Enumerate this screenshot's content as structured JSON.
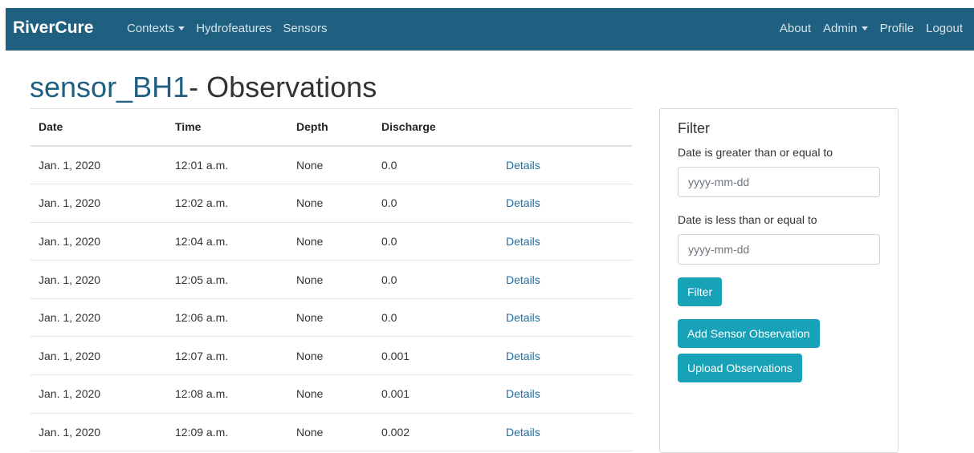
{
  "navbar": {
    "brand": "RiverCure",
    "left_links": [
      {
        "label": "Contexts",
        "dropdown": true
      },
      {
        "label": "Hydrofeatures",
        "dropdown": false
      },
      {
        "label": "Sensors",
        "dropdown": false
      }
    ],
    "right_links": [
      {
        "label": "About",
        "dropdown": false
      },
      {
        "label": "Admin",
        "dropdown": true
      },
      {
        "label": "Profile",
        "dropdown": false
      },
      {
        "label": "Logout",
        "dropdown": false
      }
    ],
    "background_color": "#1f5f80"
  },
  "page": {
    "sensor_name": "sensor_BH1",
    "title_suffix": "- Observations"
  },
  "table": {
    "headers": [
      "Date",
      "Time",
      "Depth",
      "Discharge"
    ],
    "rows": [
      {
        "date": "Jan. 1, 2020",
        "time": "12:01 a.m.",
        "depth": "None",
        "discharge": "0.0",
        "link": "Details"
      },
      {
        "date": "Jan. 1, 2020",
        "time": "12:02 a.m.",
        "depth": "None",
        "discharge": "0.0",
        "link": "Details"
      },
      {
        "date": "Jan. 1, 2020",
        "time": "12:04 a.m.",
        "depth": "None",
        "discharge": "0.0",
        "link": "Details"
      },
      {
        "date": "Jan. 1, 2020",
        "time": "12:05 a.m.",
        "depth": "None",
        "discharge": "0.0",
        "link": "Details"
      },
      {
        "date": "Jan. 1, 2020",
        "time": "12:06 a.m.",
        "depth": "None",
        "discharge": "0.0",
        "link": "Details"
      },
      {
        "date": "Jan. 1, 2020",
        "time": "12:07 a.m.",
        "depth": "None",
        "discharge": "0.001",
        "link": "Details"
      },
      {
        "date": "Jan. 1, 2020",
        "time": "12:08 a.m.",
        "depth": "None",
        "discharge": "0.001",
        "link": "Details"
      },
      {
        "date": "Jan. 1, 2020",
        "time": "12:09 a.m.",
        "depth": "None",
        "discharge": "0.002",
        "link": "Details"
      }
    ]
  },
  "filter": {
    "title": "Filter",
    "date_gte_label": "Date is greater than or equal to",
    "date_gte_placeholder": "yyyy-mm-dd",
    "date_lte_label": "Date is less than or equal to",
    "date_lte_placeholder": "yyyy-mm-dd",
    "filter_button": "Filter",
    "add_button": "Add Sensor Observation",
    "upload_button": "Upload Observations",
    "button_color": "#17a2b8"
  }
}
